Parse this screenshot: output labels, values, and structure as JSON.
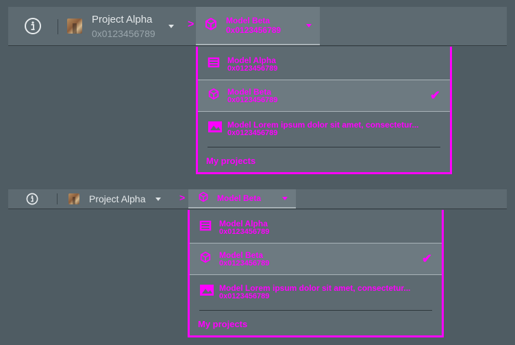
{
  "project": {
    "name": "Project Alpha",
    "address": "0x0123456789"
  },
  "breadcrumb_separator": ">",
  "selector": {
    "label": "Model Beta",
    "address": "0x0123456789"
  },
  "options": [
    {
      "label": "Model Alpha",
      "address": "0x0123456789",
      "icon": "box-icon"
    },
    {
      "label": "Model Beta",
      "address": "0x0123456789",
      "icon": "cube-icon",
      "selected": true
    },
    {
      "label": "Model Lorem ipsum dolor sit amet, consectetur...",
      "address": "0x0123456789",
      "icon": "image-icon"
    }
  ],
  "check_glyph": "✔",
  "footer_link": "My projects"
}
